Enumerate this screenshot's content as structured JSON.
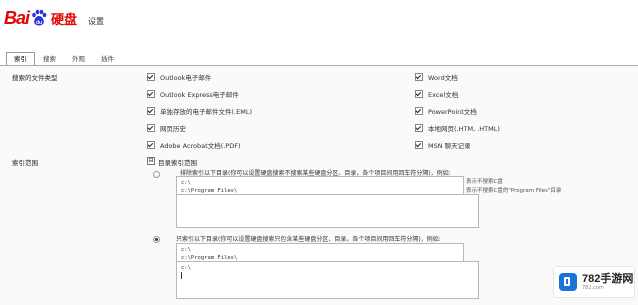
{
  "header": {
    "logo": {
      "bai": "Bai",
      "du": "du",
      "cn": "硬盘"
    },
    "title": "设置"
  },
  "tabs": [
    {
      "label": "索引",
      "active": true
    },
    {
      "label": "搜索",
      "active": false
    },
    {
      "label": "外观",
      "active": false
    },
    {
      "label": "插件",
      "active": false
    }
  ],
  "file_types": {
    "label": "搜索的文件类型",
    "left": [
      {
        "label": "Outlook电子邮件",
        "checked": true
      },
      {
        "label": "Outlook Express电子邮件",
        "checked": true
      },
      {
        "label": "单独存放的电子邮件文件(.EML)",
        "checked": true
      },
      {
        "label": "网页历史",
        "checked": true
      },
      {
        "label": "Adobe Acrobat文档(.PDF)",
        "checked": true
      }
    ],
    "right": [
      {
        "label": "Word文档",
        "checked": true
      },
      {
        "label": "Excel文档",
        "checked": true
      },
      {
        "label": "PowerPoint文档",
        "checked": true
      },
      {
        "label": "本地网页(.HTM, .HTML)",
        "checked": true
      },
      {
        "label": "MSN 聊天记录",
        "checked": true
      }
    ]
  },
  "index_range": {
    "label": "索引范围",
    "tree_toggle": "⊟",
    "tree_label": "目录索引范围",
    "exclude": {
      "selected": false,
      "instruction": "排除索引以下目录(你可以设置硬盘搜索不搜索某些硬盘分区、目录，各个项目间用回车符分隔)，例如:",
      "note1": "表示不搜索C盘",
      "note2": "表示不搜索C盘的\"Program Files\"目录",
      "lines": [
        "c:\\",
        "c:\\Program Files\\"
      ]
    },
    "include": {
      "selected": true,
      "instruction": "只索引以下目录(你可以设置硬盘搜索只包含某些硬盘分区、目录，各个项目间用回车符分隔)，例如:",
      "lines": [
        "c:\\",
        "c:\\Program Files\\"
      ],
      "value": "c:\\"
    }
  },
  "watermark": {
    "title": "782手游网",
    "url": "782.com"
  },
  "colors": {
    "logo_red": "#e10601",
    "logo_blue": "#2932e1",
    "watermark_blue": "#1a73d9"
  }
}
